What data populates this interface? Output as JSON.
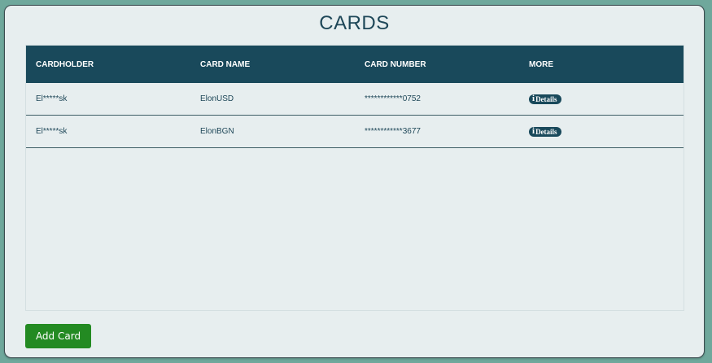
{
  "page": {
    "title": "CARDS"
  },
  "table": {
    "columns": [
      "CARDHOLDER",
      "CARD NAME",
      "CARD NUMBER",
      "MORE"
    ],
    "rows": [
      {
        "cardholder": "El*****sk",
        "card_name": "ElonUSD",
        "card_number": "************0752",
        "more_label": "Details",
        "more_icon": "info-icon"
      },
      {
        "cardholder": "El*****sk",
        "card_name": "ElonBGN",
        "card_number": "************3677",
        "more_label": "Details",
        "more_icon": "info-icon"
      }
    ]
  },
  "actions": {
    "add_card_label": "Add Card"
  },
  "colors": {
    "header_bg": "#19495b",
    "title_color": "#1e4758",
    "add_button": "#238a22",
    "background": "#6fa89c"
  }
}
